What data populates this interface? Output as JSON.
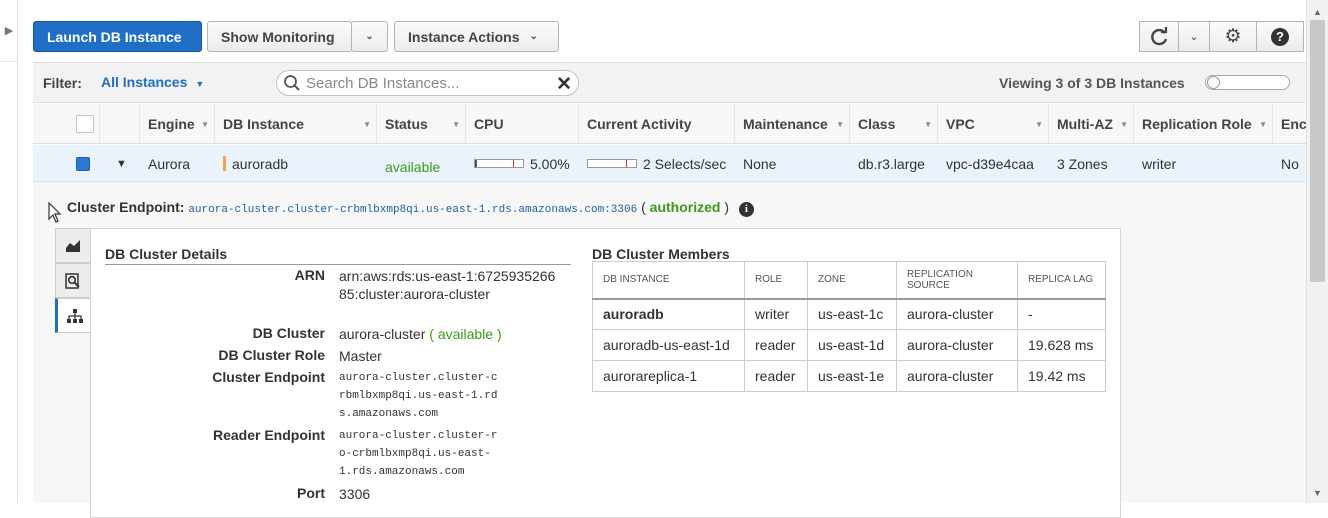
{
  "toolbar": {
    "launch_label": "Launch DB Instance",
    "monitoring_label": "Show Monitoring",
    "actions_label": "Instance Actions"
  },
  "filter": {
    "label": "Filter:",
    "selected": "All Instances",
    "search_placeholder": "Search DB Instances...",
    "viewing_text": "Viewing 3 of 3 DB Instances"
  },
  "table": {
    "columns": [
      "Engine",
      "DB Instance",
      "Status",
      "CPU",
      "Current Activity",
      "Maintenance",
      "Class",
      "VPC",
      "Multi-AZ",
      "Replication Role",
      "Enc"
    ],
    "row": {
      "engine": "Aurora",
      "db_instance": "auroradb",
      "status": "available",
      "cpu_text": "5.00%",
      "cpu_fraction": 0.05,
      "activity": "2 Selects/sec",
      "maintenance": "None",
      "class": "db.r3.large",
      "vpc": "vpc-d39e4caa",
      "multi_az": "3 Zones",
      "replication_role": "writer",
      "encrypted": "No"
    }
  },
  "detail": {
    "endpoint_label": "Cluster Endpoint:",
    "endpoint_value": "aurora-cluster.cluster-crbmlbxmp8qi.us-east-1.rds.amazonaws.com:3306",
    "auth_open": "(",
    "auth_status": "authorized",
    "auth_close": ")",
    "cluster_details_title": "DB Cluster Details",
    "arn_label": "ARN",
    "arn_value": "arn:aws:rds:us-east-1:672593526685:cluster:aurora-cluster",
    "cluster_label": "DB Cluster",
    "cluster_value": "aurora-cluster",
    "cluster_status": "( available )",
    "role_label": "DB Cluster Role",
    "role_value": "Master",
    "cluster_endpoint_label": "Cluster Endpoint",
    "cluster_endpoint_value": "aurora-cluster.cluster-crbmlbxmp8qi.us-east-1.rds.amazonaws.com",
    "reader_endpoint_label": "Reader Endpoint",
    "reader_endpoint_value": "aurora-cluster.cluster-ro-crbmlbxmp8qi.us-east-1.rds.amazonaws.com",
    "port_label": "Port",
    "port_value": "3306",
    "members_title": "DB Cluster Members",
    "members_columns": [
      "DB INSTANCE",
      "ROLE",
      "ZONE",
      "REPLICATION SOURCE",
      "REPLICA LAG"
    ],
    "members": [
      {
        "instance": "auroradb",
        "role": "writer",
        "zone": "us-east-1c",
        "source": "aurora-cluster",
        "lag": "-"
      },
      {
        "instance": "auroradb-us-east-1d",
        "role": "reader",
        "zone": "us-east-1d",
        "source": "aurora-cluster",
        "lag": "19.628 ms"
      },
      {
        "instance": "aurorareplica-1",
        "role": "reader",
        "zone": "us-east-1e",
        "source": "aurora-cluster",
        "lag": "19.42 ms"
      }
    ]
  },
  "colors": {
    "primary": "#1f6fc5",
    "available": "#3b9a1c",
    "selected_row": "#eaf3fb"
  }
}
